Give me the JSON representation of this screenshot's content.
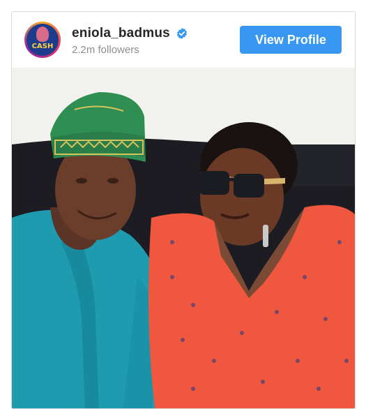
{
  "profile": {
    "username": "eniola_badmus",
    "verified": true,
    "followers": "2.2m followers",
    "avatar_text": "CASH"
  },
  "actions": {
    "view_profile_label": "View Profile"
  },
  "icons": {
    "verified": "verified-badge-icon"
  },
  "colors": {
    "button": "#3897f0",
    "verified": "#3897f0",
    "username": "#262626",
    "followers": "#8e8e8e"
  }
}
